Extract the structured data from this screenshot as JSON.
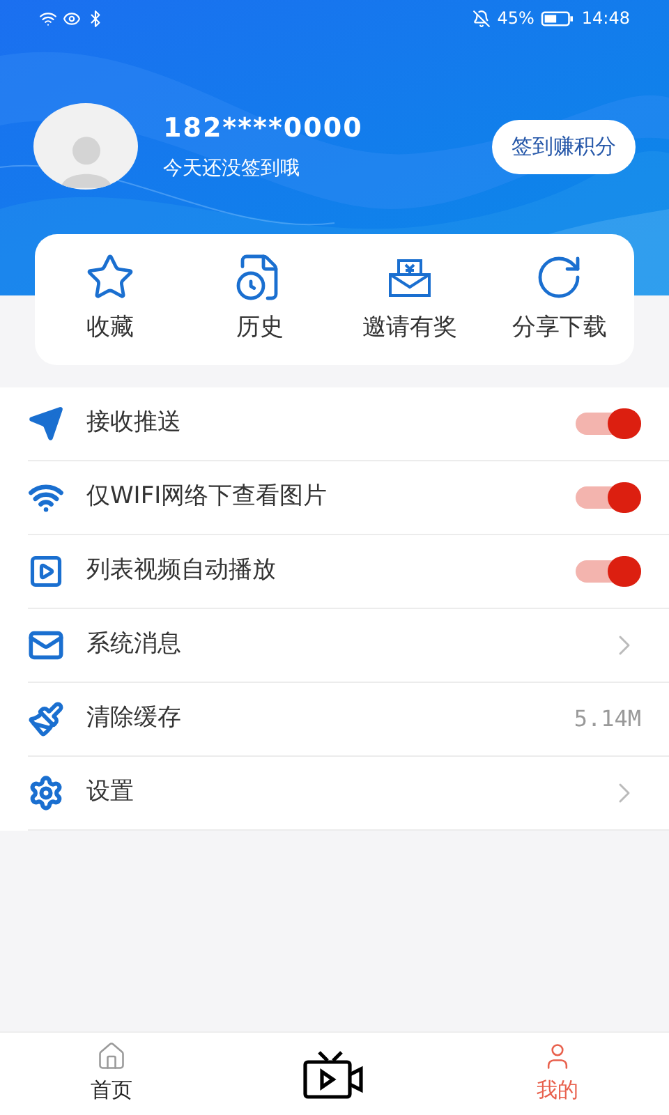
{
  "status_bar": {
    "battery": "45%",
    "time": "14:48"
  },
  "profile": {
    "phone": "182****0000",
    "subtitle": "今天还没签到哦",
    "checkin_button": "签到赚积分"
  },
  "shortcuts": [
    {
      "kind": "star",
      "label": "收藏"
    },
    {
      "kind": "history",
      "label": "历史"
    },
    {
      "kind": "invite",
      "label": "邀请有奖"
    },
    {
      "kind": "share",
      "label": "分享下载"
    }
  ],
  "settings": [
    {
      "kind": "toggle",
      "label": "接收推送",
      "on": true
    },
    {
      "kind": "toggle",
      "label": "仅WIFI网络下查看图片",
      "on": true
    },
    {
      "kind": "toggle",
      "label": "列表视频自动播放",
      "on": true
    },
    {
      "kind": "link",
      "label": "系统消息"
    },
    {
      "kind": "value",
      "label": "清除缓存",
      "value": "5.14M"
    },
    {
      "kind": "link",
      "label": "设置"
    }
  ],
  "tab_bar": [
    {
      "kind": "home",
      "label": "首页",
      "selected": false
    },
    {
      "kind": "tv"
    },
    {
      "kind": "user",
      "label": "我的",
      "selected": true
    }
  ]
}
